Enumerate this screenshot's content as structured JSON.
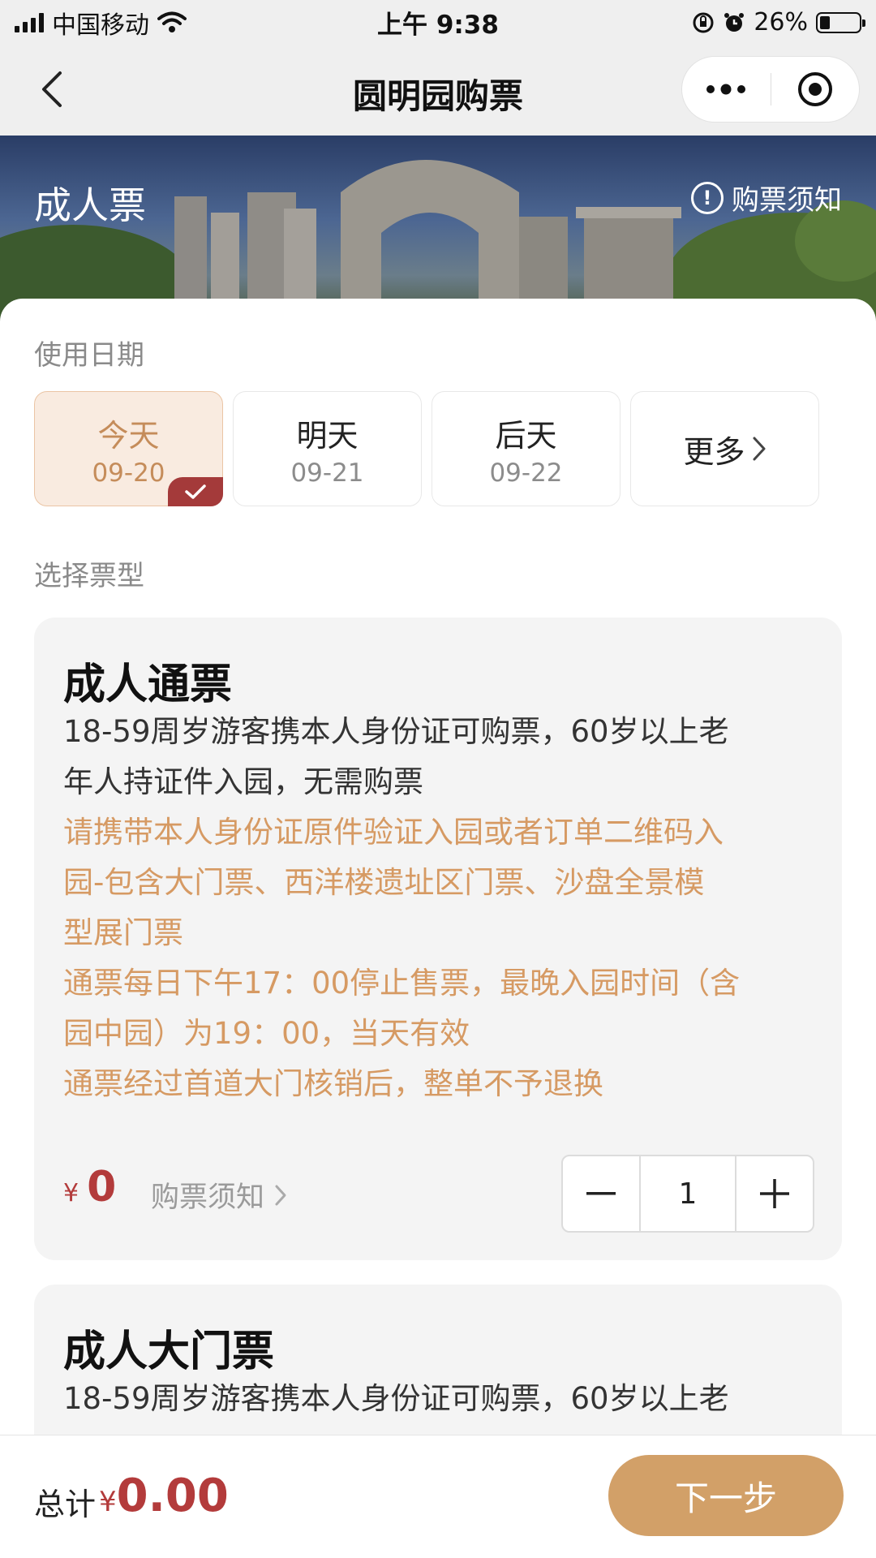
{
  "status_bar": {
    "carrier": "中国移动",
    "time": "上午 9:38",
    "battery_text": "26%",
    "battery_level": 0.26
  },
  "nav": {
    "title": "圆明园购票"
  },
  "banner": {
    "ticket_type": "成人票",
    "notice_label": "购票须知"
  },
  "date_section": {
    "label": "使用日期",
    "options": [
      {
        "label": "今天",
        "date": "09-20",
        "selected": true
      },
      {
        "label": "明天",
        "date": "09-21",
        "selected": false
      },
      {
        "label": "后天",
        "date": "09-22",
        "selected": false
      }
    ],
    "more_label": "更多"
  },
  "ticket_section": {
    "label": "选择票型",
    "tickets": [
      {
        "title": "成人通票",
        "desc_lines": [
          "18-59周岁游客携本人身份证可购票，60岁以上老",
          "年人持证件入园，无需购票"
        ],
        "note_lines": [
          "请携带本人身份证原件验证入园或者订单二维码入",
          "园-包含大门票、西洋楼遗址区门票、沙盘全景模",
          "型展门票",
          "通票每日下午17：00停止售票，最晚入园时间（含",
          "园中园）为19：00，当天有效",
          "通票经过首道大门核销后，整单不予退换"
        ],
        "currency": "¥",
        "price": "0",
        "notice_label": "购票须知",
        "quantity": "1"
      },
      {
        "title": "成人大门票",
        "desc_lines": [
          "18-59周岁游客携本人身份证可购票，60岁以上老"
        ]
      }
    ]
  },
  "footer": {
    "total_label": "总计",
    "currency": "¥",
    "total": "0.00",
    "next_label": "下一步"
  }
}
